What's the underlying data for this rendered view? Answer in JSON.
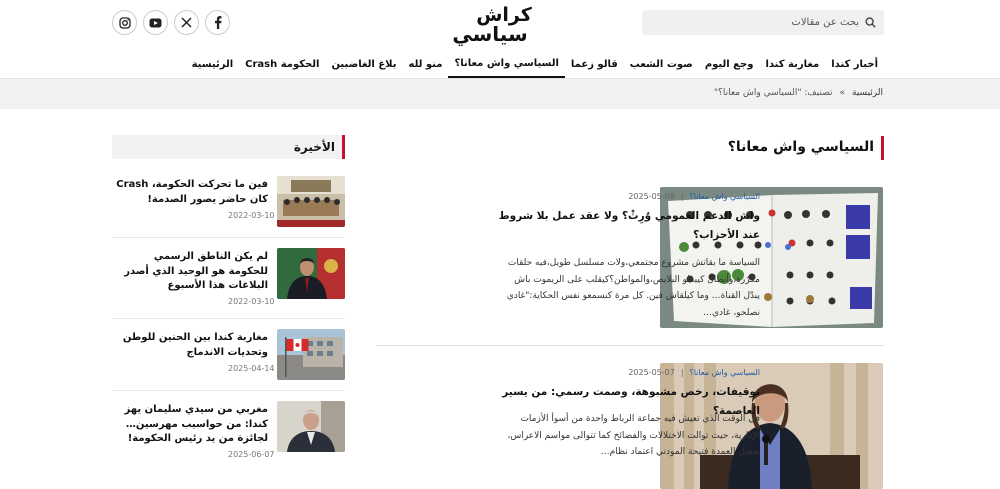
{
  "header": {
    "search_placeholder": "بحث عن مقالات",
    "logo_line1": "كراش",
    "logo_line2": "سياسي"
  },
  "social": [
    "facebook-icon",
    "x-icon",
    "youtube-icon",
    "instagram-icon"
  ],
  "nav": {
    "items": [
      "الرئيسية",
      "الحكومة Crash",
      "بلاغ الغاضبين",
      "منو لله",
      "السياسي واش معانا؟",
      "قالو زعما",
      "صوت الشعب",
      "وجع اليوم",
      "مغاربة كندا",
      "أخبار كندا"
    ],
    "active_index": 4
  },
  "breadcrumb": {
    "home": "الرئيسية",
    "separator": "»",
    "current": "تصنيف: \"السياسي واش معانا؟\""
  },
  "main": {
    "title": "السياسي واش معانا؟",
    "articles": [
      {
        "category": "السياسي واش معانا؟",
        "date": "2025-05-08",
        "title": "واش الدعم العمومي وُرِثْ؟ ولا عقد عمل بلا شروط عند الأحزاب؟",
        "excerpt": "السياسة ما بقاتش مشروع مجتمعي،ولات مسلسل طويل،فيه حلقات مكرّرة،وأبطال كيبدلو البلايص،والمواطن؟كيقلب على الريموت باش يبدّل القناة… وما كيلقاش فين. كل مرة كنسمعو نفس الحكاية:\"غادي نصلحو، غادي…"
      },
      {
        "category": "السياسي واش معانا؟",
        "date": "2025-05-07",
        "title": "توقيفات، رخص مشبوهة، وصمت رسمي: من يسير العاصمة؟",
        "excerpt": "في الوقت الذي تعيش فيه جماعة الرباط واحدة من أسوأ الأزمات الإدارية، حيث توالت الاختلالات والفضائح كما تتوالى مواسم الاعراس، تفضل العمدة فتيحة المودني اعتماد نظام…"
      }
    ]
  },
  "sidebar": {
    "title": "الأخيرة",
    "items": [
      {
        "title": "فين ما تحركت الحكومة، Crash كان حاضر يصور الصدمة!",
        "date": "2022-03-10"
      },
      {
        "title": "لم يكن الناطق الرسمي للحكومة هو الوحيد الذي أصدر البلاغات هذا الأسبوع",
        "date": "2022-03-10"
      },
      {
        "title": "مغاربة كندا بين الحنين للوطن وتحديات الاندماج",
        "date": "2025-04-14"
      },
      {
        "title": "مغربي من سيدي سليمان يهز كندا: من حواسيب مهرسين… لجائزة من يد رئيس الحكومة!",
        "date": "2025-06-07"
      }
    ]
  }
}
